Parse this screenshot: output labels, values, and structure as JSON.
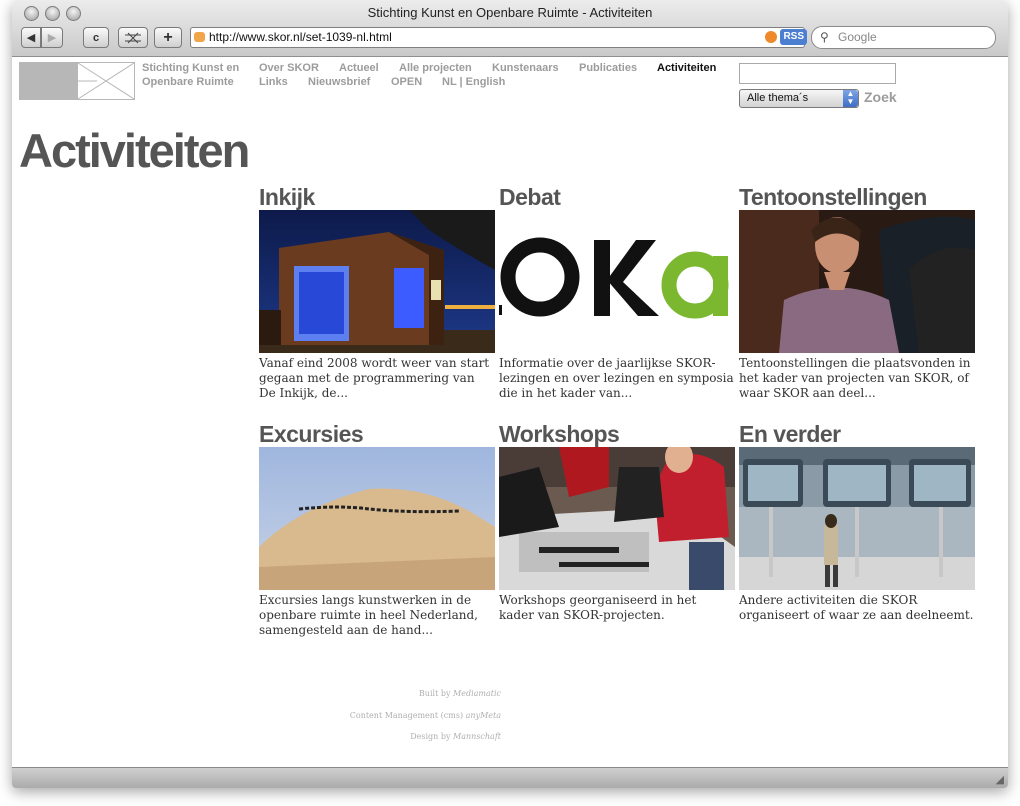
{
  "window": {
    "title": "Stichting Kunst en Openbare Ruimte - Activiteiten"
  },
  "toolbar": {
    "url": "http://www.skor.nl/set-1039-nl.html",
    "rss_label": "RSS",
    "search_placeholder": "Google",
    "back_icon": "◀",
    "forward_icon": "▶",
    "reload_icon": "c",
    "add_icon": "+"
  },
  "site": {
    "name_line1": "Stichting Kunst en",
    "name_line2": "Openbare Ruimte",
    "nav_row1": [
      "Over SKOR",
      "Actueel",
      "Alle projecten",
      "Kunstenaars",
      "Publicaties",
      "Activiteiten"
    ],
    "nav_row2": [
      "Links",
      "Nieuwsbrief",
      "OPEN",
      "NL | English"
    ],
    "search_select": "Alle thema´s",
    "search_button": "Zoek"
  },
  "page": {
    "title": "Activiteiten"
  },
  "cards": [
    {
      "title": "Inkijk",
      "text": "Vanaf eind 2008 wordt weer van start gegaan met de programmering van De Inkijk, de..."
    },
    {
      "title": "Debat",
      "text": "Informatie over de jaarlijkse SKOR-lezingen en over lezingen en symposia die in het kader van..."
    },
    {
      "title": "Tentoonstellingen",
      "text": "Tentoonstellingen die plaatsvonden in het kader van projecten van SKOR, of waar SKOR aan deel..."
    },
    {
      "title": "Excursies",
      "text": "Excursies langs kunstwerken in de openbare ruimte in heel Nederland, samengesteld aan de hand..."
    },
    {
      "title": "Workshops",
      "text": "Workshops georganiseerd in het kader van SKOR-projecten."
    },
    {
      "title": "En verder",
      "text": "Andere activiteiten die SKOR organiseert of waar ze aan deelneemt."
    }
  ],
  "debat_logo": "OKa",
  "footer": {
    "built_prefix": "Built by",
    "built_name": "Mediamatic",
    "cms_prefix": "Content Management (cms)",
    "cms_name": "anyMeta",
    "design_prefix": "Design by",
    "design_name": "Mannschaft"
  }
}
